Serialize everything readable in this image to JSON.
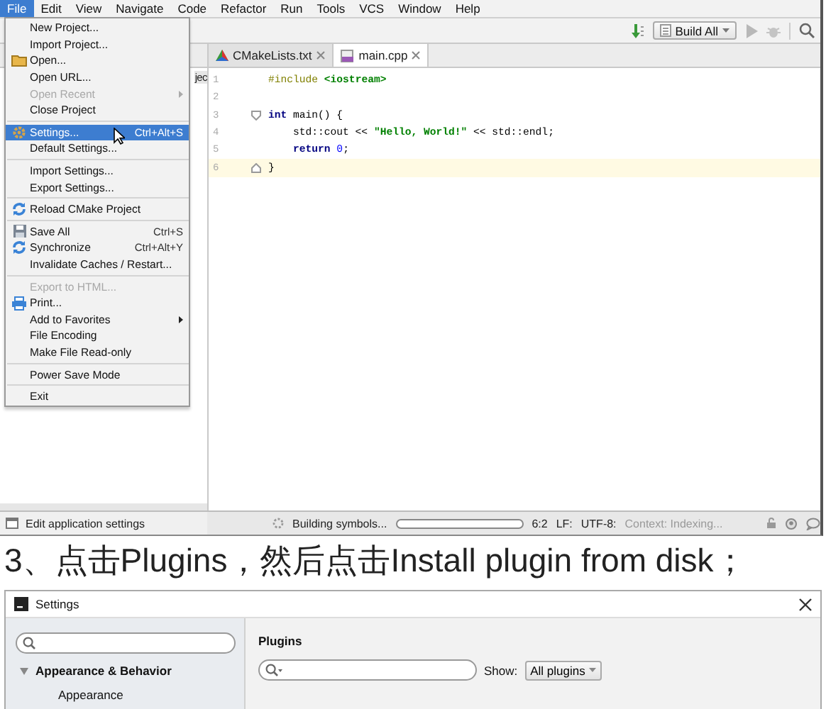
{
  "ide": {
    "menubar": [
      {
        "label": "File",
        "selected": true
      },
      {
        "label": "Edit",
        "selected": false
      },
      {
        "label": "View",
        "selected": false
      },
      {
        "label": "Navigate",
        "selected": false
      },
      {
        "label": "Code",
        "selected": false
      },
      {
        "label": "Refactor",
        "selected": false
      },
      {
        "label": "Run",
        "selected": false
      },
      {
        "label": "Tools",
        "selected": false
      },
      {
        "label": "VCS",
        "selected": false
      },
      {
        "label": "Window",
        "selected": false
      },
      {
        "label": "Help",
        "selected": false
      }
    ],
    "toolbar": {
      "configuration": "Build All"
    },
    "project_panel": {
      "fragment": "jec"
    },
    "tabs": [
      {
        "label": "CMakeLists.txt",
        "kind": "cmake",
        "selected": false
      },
      {
        "label": "main.cpp",
        "kind": "cpp",
        "selected": true
      }
    ],
    "code_lines": [
      {
        "number": "1",
        "kind": "plain",
        "current": false,
        "tokens": [
          {
            "kind": "preprocessor",
            "text": "#include "
          },
          {
            "kind": "string",
            "text": "<iostream>"
          }
        ]
      },
      {
        "number": "2",
        "kind": "plain",
        "current": false
      },
      {
        "number": "3",
        "kind": "fold_start",
        "current": false,
        "tokens": [
          {
            "kind": "keyword",
            "text": "int"
          },
          {
            "kind": "plain",
            "text": " main() {"
          }
        ]
      },
      {
        "number": "4",
        "kind": "plain",
        "current": false,
        "tokens": [
          {
            "kind": "plain",
            "text": "    std::cout << "
          },
          {
            "kind": "string",
            "text": "\"Hello, World!\""
          },
          {
            "kind": "plain",
            "text": " << std::endl;"
          }
        ]
      },
      {
        "number": "5",
        "kind": "plain",
        "current": false,
        "tokens": [
          {
            "kind": "keyword",
            "text": "    return"
          },
          {
            "kind": "number",
            "text": " 0"
          },
          {
            "kind": "plain",
            "text": ";"
          }
        ]
      },
      {
        "number": "6",
        "kind": "fold_end",
        "current": true,
        "tokens": [
          {
            "kind": "plain",
            "text": "}"
          }
        ]
      }
    ],
    "file_menu": {
      "groups": [
        [
          {
            "label": "New Project...",
            "disabled": false,
            "selected": false,
            "submenu": false
          },
          {
            "label": "Import Project...",
            "disabled": false,
            "selected": false,
            "submenu": false
          },
          {
            "label": "Open...",
            "kind": "folder",
            "disabled": false,
            "selected": false,
            "submenu": false
          },
          {
            "label": "Open URL...",
            "disabled": false,
            "selected": false,
            "submenu": false
          },
          {
            "label": "Open Recent",
            "disabled": true,
            "selected": false,
            "submenu": true
          },
          {
            "label": "Close Project",
            "disabled": false,
            "selected": false,
            "submenu": false
          }
        ],
        [
          {
            "label": "Settings...",
            "kind": "gear",
            "shortcut": "Ctrl+Alt+S",
            "disabled": false,
            "selected": true,
            "submenu": false
          },
          {
            "label": "Default Settings...",
            "disabled": false,
            "selected": false,
            "submenu": false
          }
        ],
        [
          {
            "label": "Import Settings...",
            "disabled": false,
            "selected": false,
            "submenu": false
          },
          {
            "label": "Export Settings...",
            "disabled": false,
            "selected": false,
            "submenu": false
          }
        ],
        [
          {
            "label": "Reload CMake Project",
            "kind": "reload",
            "disabled": false,
            "selected": false,
            "submenu": false
          }
        ],
        [
          {
            "label": "Save All",
            "kind": "save",
            "shortcut": "Ctrl+S",
            "disabled": false,
            "selected": false,
            "submenu": false
          },
          {
            "label": "Synchronize",
            "kind": "reload",
            "shortcut": "Ctrl+Alt+Y",
            "disabled": false,
            "selected": false,
            "submenu": false
          },
          {
            "label": "Invalidate Caches / Restart...",
            "disabled": false,
            "selected": false,
            "submenu": false
          }
        ],
        [
          {
            "label": "Export to HTML...",
            "disabled": true,
            "selected": false,
            "submenu": false
          },
          {
            "label": "Print...",
            "kind": "printer",
            "disabled": false,
            "selected": false,
            "submenu": false
          },
          {
            "label": "Add to Favorites",
            "disabled": false,
            "selected": false,
            "submenu": true
          },
          {
            "label": "File Encoding",
            "disabled": false,
            "selected": false,
            "submenu": false
          },
          {
            "label": "Make File Read-only",
            "disabled": false,
            "selected": false,
            "submenu": false
          }
        ],
        [
          {
            "label": "Power Save Mode",
            "disabled": false,
            "selected": false,
            "submenu": false
          }
        ],
        [
          {
            "label": "Exit",
            "disabled": false,
            "selected": false,
            "submenu": false
          }
        ]
      ]
    },
    "status_bar": {
      "message": "Edit application settings",
      "task": "Building symbols...",
      "level": 0,
      "position": "6:2",
      "line_separator": "LF:",
      "encoding": "UTF-8:",
      "context": "Context: Indexing..."
    }
  },
  "caption": "3、点击Plugins，然后点击Install plugin from disk；",
  "settings": {
    "title": "Settings",
    "tree": [
      {
        "label": "Appearance & Behavior",
        "expanded": true,
        "children": [
          {
            "label": "Appearance"
          }
        ]
      }
    ],
    "heading": "Plugins",
    "show_label": "Show:",
    "show_value": "All plugins"
  }
}
